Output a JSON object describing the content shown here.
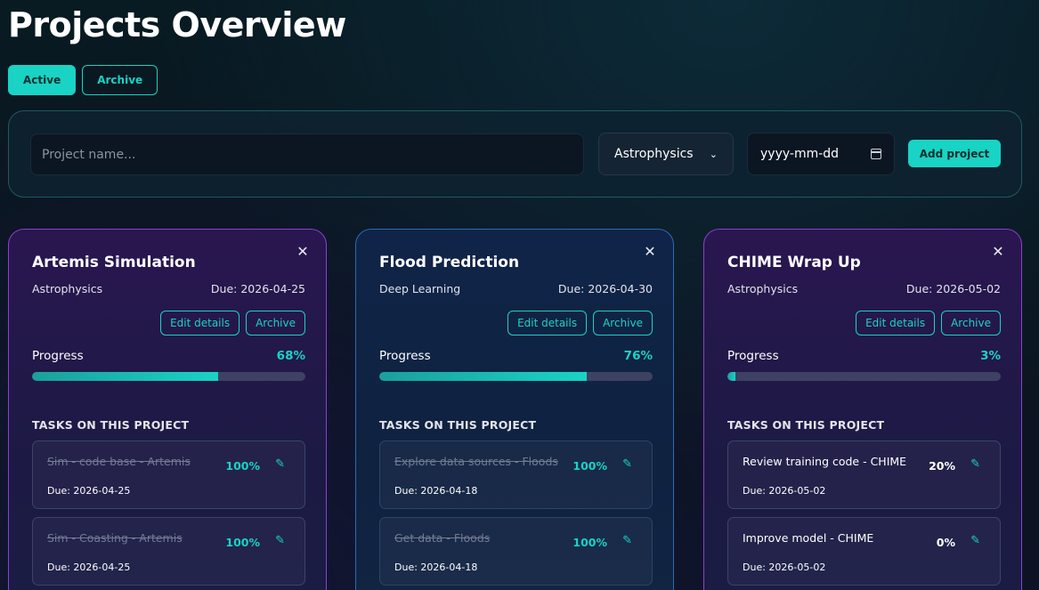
{
  "page": {
    "title": "Projects Overview"
  },
  "tabs": [
    {
      "label": "Active",
      "active": true
    },
    {
      "label": "Archive",
      "active": false
    }
  ],
  "form": {
    "name_placeholder": "Project name...",
    "category_selected": "Astrophysics",
    "date_placeholder": "yyyy-mm-dd",
    "add_label": "Add project"
  },
  "colors": {
    "accent": "#19d3c5",
    "purple_border": "#8c3fcf",
    "blue_border": "#2d6bb4"
  },
  "icons": {
    "close": "close-icon",
    "edit": "pencil-icon",
    "calendar": "calendar-icon",
    "dropdown": "chevron-down-icon"
  },
  "card_labels": {
    "edit": "Edit details",
    "archive": "Archive",
    "progress": "Progress",
    "tasks_heading": "TASKS ON THIS PROJECT"
  },
  "projects": [
    {
      "title": "Artemis Simulation",
      "category": "Astrophysics",
      "due": "Due: 2026-04-25",
      "progress": "68%",
      "progress_fraction": 0.68,
      "theme": "purple",
      "tasks": [
        {
          "name": "Sim - code base - Artemis",
          "due": "Due: 2026-04-25",
          "pct": "100%",
          "done": true
        },
        {
          "name": "Sim - Coasting - Artemis",
          "due": "Due: 2026-04-25",
          "pct": "100%",
          "done": true
        }
      ]
    },
    {
      "title": "Flood Prediction",
      "category": "Deep Learning",
      "due": "Due: 2026-04-30",
      "progress": "76%",
      "progress_fraction": 0.76,
      "theme": "blue",
      "tasks": [
        {
          "name": "Explore data sources - Floods",
          "due": "Due: 2026-04-18",
          "pct": "100%",
          "done": true
        },
        {
          "name": "Get data - Floods",
          "due": "Due: 2026-04-18",
          "pct": "100%",
          "done": true
        }
      ]
    },
    {
      "title": "CHIME Wrap Up",
      "category": "Astrophysics",
      "due": "Due: 2026-05-02",
      "progress": "3%",
      "progress_fraction": 0.03,
      "theme": "purple",
      "tasks": [
        {
          "name": "Review training code - CHIME",
          "due": "Due: 2026-05-02",
          "pct": "20%",
          "done": false
        },
        {
          "name": "Improve model - CHIME",
          "due": "Due: 2026-05-02",
          "pct": "0%",
          "done": false
        }
      ]
    }
  ]
}
